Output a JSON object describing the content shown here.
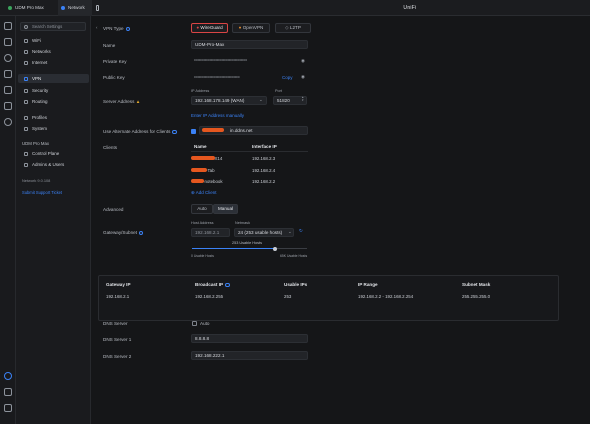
{
  "tabs": [
    {
      "label": "UDM Pro Max"
    },
    {
      "label": "Network"
    }
  ],
  "window_title": "UniFi",
  "sidebar": {
    "search_placeholder": "Search Settings",
    "items": [
      {
        "label": "WiFi",
        "icon": "wifi-icon"
      },
      {
        "label": "Networks",
        "icon": "networks-icon"
      },
      {
        "label": "Internet",
        "icon": "internet-icon"
      },
      {
        "label": "VPN",
        "icon": "vpn-icon",
        "selected": true
      },
      {
        "label": "Security",
        "icon": "shield-icon"
      },
      {
        "label": "Routing",
        "icon": "routing-icon"
      },
      {
        "label": "Profiles",
        "icon": "profiles-icon"
      },
      {
        "label": "System",
        "icon": "gear-icon"
      }
    ],
    "device_heading": "UDM Pro Max",
    "device_items": [
      {
        "label": "Control Plane",
        "icon": "control-plane-icon"
      },
      {
        "label": "Admins & Users",
        "icon": "users-icon"
      }
    ],
    "version": "Network 9.0.108",
    "support_link": "Submit Support Ticket"
  },
  "form": {
    "vpn_type_label": "VPN Type",
    "vpn_types": [
      "WireGuard",
      "OpenVPN",
      "L2TP"
    ],
    "vpn_type_selected": "WireGuard",
    "name_label": "Name",
    "name_value": "UDM-Pro-Max",
    "private_key_label": "Private Key",
    "private_key_value": "••••••••••••••••••••••••••••••••••••••••••••",
    "public_key_label": "Public Key",
    "public_key_value": "••••••••••••••••••••••••••••••••••••••",
    "copy_label": "Copy",
    "server_address_label": "Server Address",
    "ip_address_label": "IP Address",
    "ip_address_value": "192.168.178.149 (WAN)",
    "port_label": "Port",
    "port_value": "51820",
    "enter_ip_link": "Enter IP Address manually",
    "alt_address_label": "Use Alternate Address for Clients",
    "alt_address_value": "in.ddns.net",
    "alt_address_checked": true,
    "clients_label": "Clients",
    "clients_header": [
      "Name",
      "Interface IP"
    ],
    "clients": [
      {
        "name": "-X14",
        "ip": "192.168.2.3"
      },
      {
        "name": "-Tab",
        "ip": "192.168.2.4"
      },
      {
        "name": "-notebook",
        "ip": "192.168.2.2"
      }
    ],
    "add_client_label": "Add Client",
    "advanced_label": "Advanced",
    "advanced_modes": [
      "Auto",
      "Manual"
    ],
    "advanced_selected": "Manual",
    "gateway_label": "Gateway/Subnet",
    "host_address_label": "Host Address",
    "host_address_value": "192.168.2.1",
    "netmask_label": "Netmask",
    "netmask_value": "24 (253 usable hosts)",
    "usable_hosts_label": "253 Usable Hosts",
    "slider_min_label": "0 Usable Hosts",
    "slider_max_label": "65K Usable Hosts",
    "slider_position": 0.72,
    "subnet_table": {
      "headers": [
        "Gateway IP",
        "Broadcast IP",
        "Usable IPs",
        "IP Range",
        "Subnet Mask"
      ],
      "row": [
        "192.168.2.1",
        "192.168.2.255",
        "253",
        "192.168.2.2 - 192.168.2.254",
        "255.255.255.0"
      ]
    },
    "dns_server_label": "DNS Server",
    "dns_auto_label": "Auto",
    "dns_auto_checked": false,
    "dns1_label": "DNS Server 1",
    "dns1_value": "8.8.8.8",
    "dns2_label": "DNS Server 2",
    "dns2_value": "192.168.222.1"
  },
  "colors": {
    "accent": "#3b82f6",
    "wireguard": "#d94545",
    "redaction": "#e5571f",
    "background": "#151618"
  }
}
